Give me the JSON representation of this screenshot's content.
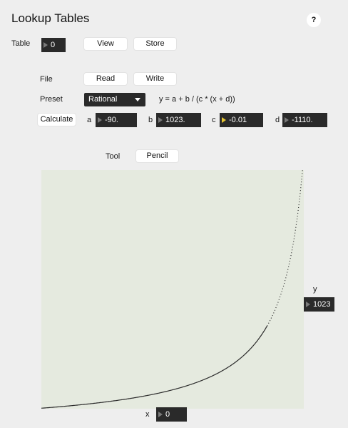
{
  "title": "Lookup Tables",
  "help_label": "?",
  "table": {
    "label": "Table",
    "value": "0",
    "view_label": "View",
    "store_label": "Store"
  },
  "file": {
    "label": "File",
    "read_label": "Read",
    "write_label": "Write"
  },
  "preset": {
    "label": "Preset",
    "value": "Rational",
    "formula": "y = a + b / (c * (x + d))"
  },
  "calculate": {
    "button_label": "Calculate",
    "params": [
      {
        "name": "a",
        "value": "-90."
      },
      {
        "name": "b",
        "value": "1023."
      },
      {
        "name": "c",
        "value": "-0.01"
      },
      {
        "name": "d",
        "value": "-1110."
      }
    ]
  },
  "tool": {
    "label": "Tool",
    "value": "Pencil"
  },
  "readout": {
    "x_label": "x",
    "x_value": "0",
    "y_label": "y",
    "y_value": "1023"
  },
  "colors": {
    "plot_bg": "#e5eadf",
    "curve": "#2b2b2b",
    "number_box": "#2a2a2a",
    "active_arrow": "#e6c533"
  },
  "chart_data": {
    "type": "line",
    "function": "y = a + b / (c * (x + d))",
    "a": -90,
    "b": 1023,
    "c": -0.01,
    "d": -1110,
    "x_range": [
      0,
      1023
    ],
    "y_range": [
      0,
      1023
    ],
    "grid": false
  }
}
